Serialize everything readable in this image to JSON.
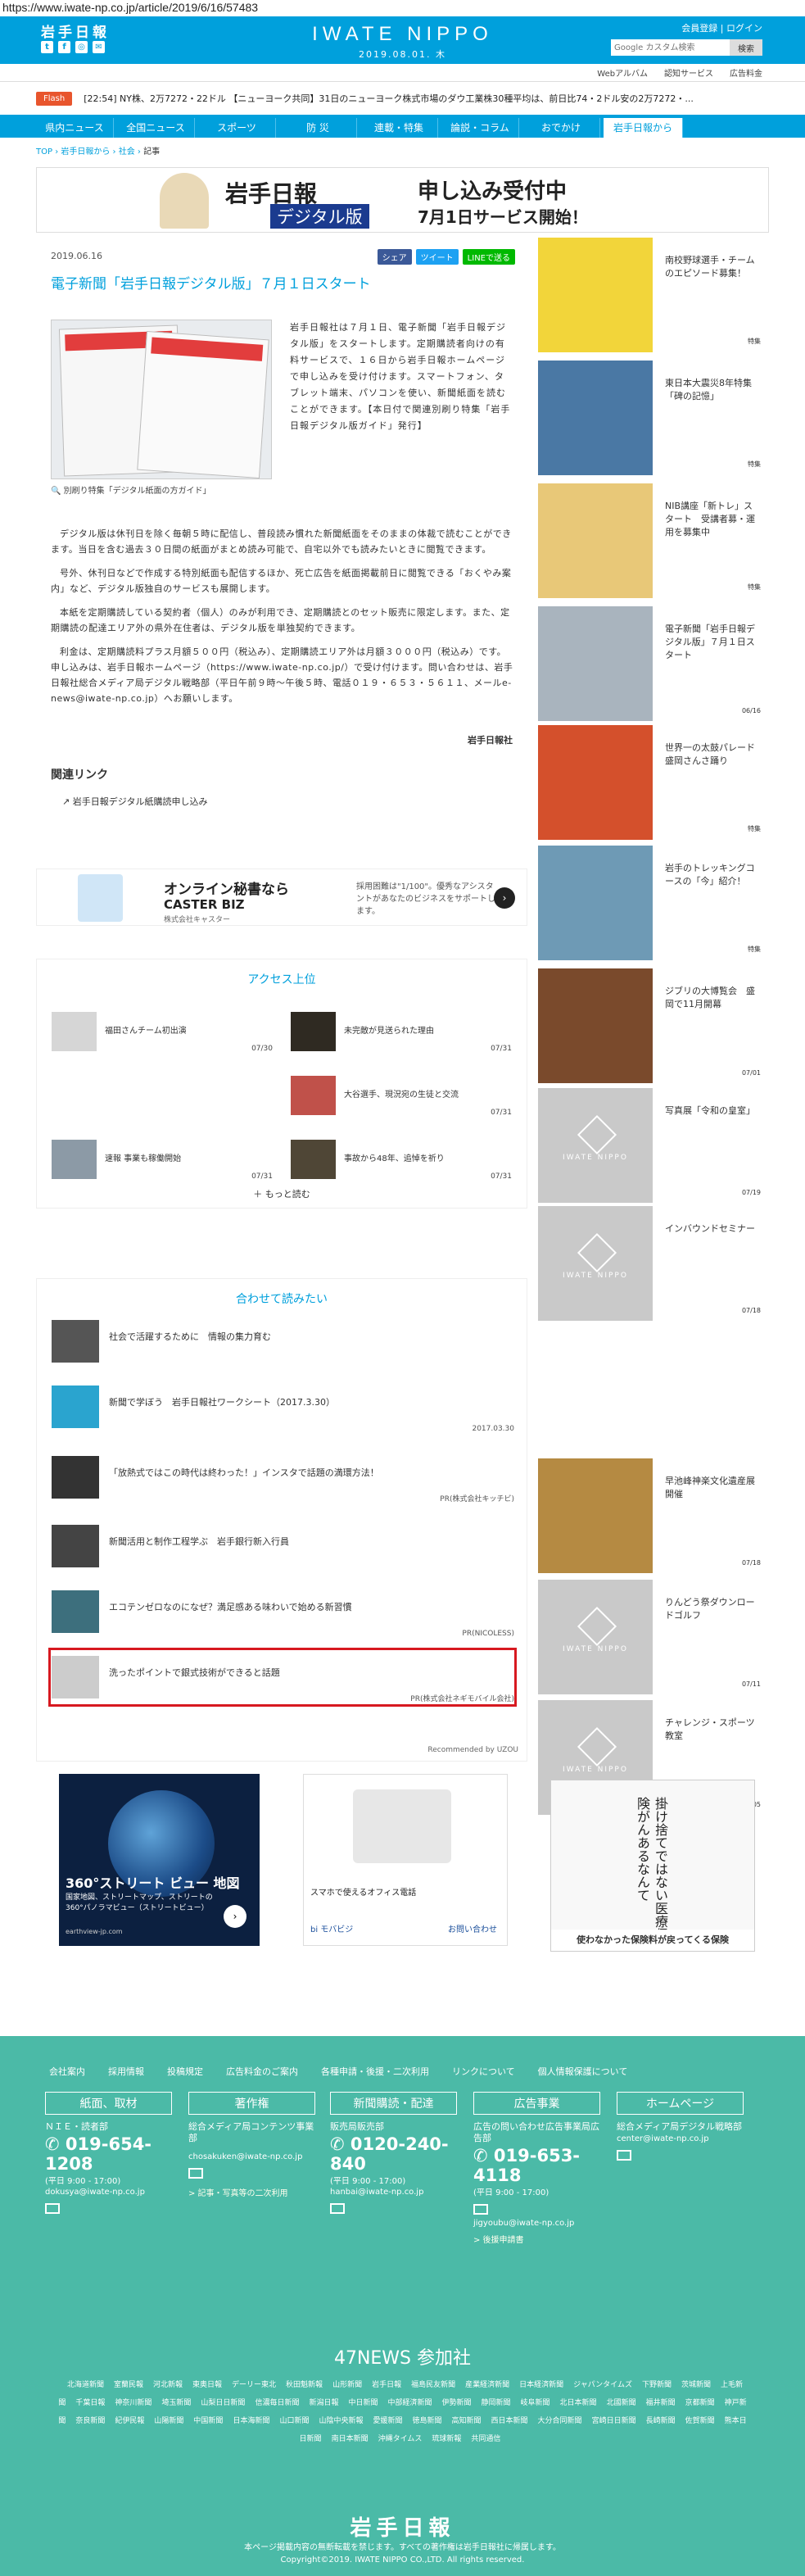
{
  "url": "https://www.iwate-np.co.jp/article/2019/6/16/57483",
  "header": {
    "logo": "岩手日報",
    "brand": "IWATE NIPPO",
    "date": "2019.08.01. 木",
    "member": "会員登録 | ログイン",
    "search_placeholder": "Google カスタム検索",
    "search_button": "検索"
  },
  "subnav": [
    "Webアルバム",
    "認知サービス",
    "広告料金"
  ],
  "flash": {
    "tag": "Flash",
    "text": "[22:54] NY株、2万7272・22ドル 【ニューヨーク共同】31日のニューヨーク株式市場のダウ工業株30種平均は、前日比74・2ドル安の2万7272・..."
  },
  "nav": [
    "県内ニュース",
    "全国ニュース",
    "スポーツ",
    "防 災",
    "連載・特集",
    "論説・コラム",
    "おでかけ",
    "岩手日報から"
  ],
  "breadcrumb": {
    "top": "TOP",
    "s1": "岩手日報から",
    "s2": "社会",
    "cur": "記事"
  },
  "banner": {
    "t1": "岩手日報",
    "t2": "デジタル版",
    "t3": "申し込み受付中",
    "t4": "7月1日サービス開始！"
  },
  "article": {
    "date": "2019.06.16",
    "share": {
      "fb": "シェア",
      "tw": "ツイート",
      "line": "LINEで送る"
    },
    "title": "電子新聞「岩手日報デジタル版」７月１日スタート",
    "caption": "別刷り特集「デジタル紙面の方ガイド」",
    "p1": "岩手日報社は７月１日、電子新聞「岩手日報デジタル版」をスタートします。定期購読者向けの有料サービスで、１６日から岩手日報ホームページで申し込みを受け付けます。スマートフォン、タブレット端末、パソコンを使い、新聞紙面を読むことができます。【本日付で関連別刷り特集「岩手日報デジタル版ガイド」発行】",
    "p2": "デジタル版は休刊日を除く毎朝５時に配信し、普段読み慣れた新聞紙面をそのままの体裁で読むことができます。当日を含む過去３０日間の紙面がまとめ読み可能で、自宅以外でも読みたいときに閲覧できます。",
    "p3": "号外、休刊日などで作成する特別紙面も配信するほか、死亡広告を紙面掲載前日に閲覧できる「おくやみ案内」など、デジタル版独自のサービスも展開します。",
    "p4": "本紙を定期購読している契約者（個人）のみが利用でき、定期購読とのセット販売に限定します。また、定期購読の配達エリア外の県外在住者は、デジタル版を単独契約できます。",
    "p5": "利金は、定期購読料プラス月額５００円（税込み）、定期購読エリア外は月額３０００円（税込み）です。申し込みは、岩手日報ホームページ（https://www.iwate-np.co.jp/）で受け付けます。問い合わせは、岩手日報社総合メディア局デジタル戦略部（平日午前９時～午後５時、電話０１９・６５３・５６１１、メールe-news@iwate-np.co.jp）へお願いします。",
    "sig": "岩手日報社",
    "related_title": "関連リンク",
    "related_link": "岩手日報デジタル紙購読申し込み"
  },
  "ad1": {
    "a": "オンライン秘書なら",
    "b": "CASTER BIZ",
    "c": "株式会社キャスター",
    "d": "採用困難は\"1/100\"。優秀なアシスタントがあなたのビジネスをサポートします。"
  },
  "rank": {
    "title": "アクセス上位",
    "items": [
      {
        "t": "福田さんチーム初出演",
        "d": "07/30"
      },
      {
        "t": "未完敵が見送られた理由",
        "d": "07/31"
      },
      {
        "t": "大谷選手、現況宛の生徒と交流",
        "d": "07/31"
      },
      {
        "t": "速報 事業も稼働開始",
        "d": "07/31"
      },
      {
        "t": "事故から48年、追悼を祈り",
        "d": "07/31"
      }
    ],
    "more": "＋ もっと読む"
  },
  "reco": {
    "title": "合わせて読みたい",
    "items": [
      {
        "t": "社会で活躍するために　情報の集力育む",
        "s": ""
      },
      {
        "t": "新聞で学ぼう　岩手日報社ワークシート（2017.3.30）",
        "s": "2017.03.30"
      },
      {
        "t": "「放熱式ではこの時代は終わった！」インスタで話題の満環方法！",
        "s": "PR(株式会社キッチビ)"
      },
      {
        "t": "新聞活用と制作工程学ぶ　岩手銀行新入行員",
        "s": ""
      },
      {
        "t": "エコテンゼロなのになぜ？満足感ある味わいで始める新習慣",
        "s": "PR(NICOLESS)"
      },
      {
        "t": "洗ったポイントで銀式技術ができると話題",
        "s": "PR(株式会社ネギモバイル会社)"
      }
    ],
    "powered": "Recommended by UZOU"
  },
  "ad2": {
    "t1": "360°ストリート ビュー 地図",
    "t2": "国家地図、ストリートマップ、ストリートの360°パノラマビュー（ストリートビュー）",
    "t3": "earthview-jp.com"
  },
  "ad3": {
    "t1": "スマホで使えるオフィス電話",
    "t2": "bi モバビジ",
    "t3": "お問い合わせ"
  },
  "side": [
    {
      "t": "南校野球選手・チームのエピソード募集！",
      "c": "特集"
    },
    {
      "t": "東日本大震災8年特集「碑の記憶」",
      "c": "特集"
    },
    {
      "t": "NIB講座「新トレ」スタート　受講者募・運用を募集中",
      "c": "特集"
    },
    {
      "t": "電子新聞「岩手日報デジタル版」７月１日スタート",
      "c": "06/16"
    },
    {
      "t": "世界一の太鼓パレード　盛岡さんさ踊り",
      "c": "特集"
    },
    {
      "t": "岩手のトレッキングコースの「今」紹介！",
      "c": "特集"
    },
    {
      "t": "ジブリの大博覧会　盛岡で11月開幕",
      "c": "07/01"
    },
    {
      "t": "写真展「令和の皇室」",
      "c": "07/19"
    },
    {
      "t": "インバウンドセミナー",
      "c": "07/18"
    },
    {
      "t": "早池峰神楽文化遺産展開催",
      "c": "07/18"
    },
    {
      "t": "りんどう祭ダウンロードゴルフ",
      "c": "07/11"
    },
    {
      "t": "チャレンジ・スポーツ教室",
      "c": "07/05"
    }
  ],
  "side_ad": {
    "txt": "掛け捨てではない医療保険がんあるなんて",
    "bot": "使わなかった保険料が戻ってくる保険"
  },
  "footer": {
    "nav": [
      "会社案内",
      "採用情報",
      "投稿規定",
      "広告料金のご案内",
      "各種申請・後援・二次利用",
      "リンクについて",
      "個人情報保護について"
    ],
    "cols": [
      {
        "h": "紙面、取材",
        "l": "ＮＩＥ・読者部",
        "tel": "019-654-1208",
        "sm": "(平日 9:00 - 17:00)",
        "mail": "dokusya@iwate-np.co.jp",
        "lnk": ""
      },
      {
        "h": "著作権",
        "l": "総合メディア局コンテンツ事業部",
        "tel": "",
        "sm": "",
        "mail": "chosakuken@iwate-np.co.jp",
        "lnk": "> 記事・写真等の二次利用"
      },
      {
        "h": "新聞購読・配達",
        "l": "販売局販売部",
        "tel": "0120-240-840",
        "sm": "(平日 9:00 - 17:00)",
        "mail": "hanbai@iwate-np.co.jp",
        "lnk": ""
      },
      {
        "h": "広告事業",
        "l": "広告の問い合わせ広告事業局広告部",
        "tel": "019-653-4118",
        "sm": "(平日 9:00 - 17:00)",
        "mail": "jigyoubu@iwate-np.co.jp",
        "lnk": "> 後援申請書"
      },
      {
        "h": "ホームページ",
        "l": "総合メディア局デジタル戦略部",
        "tel": "",
        "sm": "",
        "mail": "center@iwate-np.co.jp",
        "lnk": ""
      }
    ],
    "title47": "47NEWS 参加社",
    "pubs": [
      "北海道新聞",
      "室蘭民報",
      "河北新報",
      "東奥日報",
      "デーリー東北",
      "秋田魁新報",
      "山形新聞",
      "岩手日報",
      "福島民友新聞",
      "産業経済新聞",
      "日本経済新聞",
      "ジャパンタイムズ",
      "下野新聞",
      "茨城新聞",
      "上毛新聞",
      "千葉日報",
      "神奈川新聞",
      "埼玉新聞",
      "山梨日日新聞",
      "信濃毎日新聞",
      "新潟日報",
      "中日新聞",
      "中部経済新聞",
      "伊勢新聞",
      "静岡新聞",
      "岐阜新聞",
      "北日本新聞",
      "北國新聞",
      "福井新聞",
      "京都新聞",
      "神戸新聞",
      "奈良新聞",
      "紀伊民報",
      "山陽新聞",
      "中国新聞",
      "日本海新聞",
      "山口新聞",
      "山陰中央新報",
      "愛媛新聞",
      "徳島新聞",
      "高知新聞",
      "西日本新聞",
      "大分合同新聞",
      "宮崎日日新聞",
      "長崎新聞",
      "佐賀新聞",
      "熊本日日新聞",
      "南日本新聞",
      "沖縄タイムス",
      "琉球新報",
      "共同通信"
    ],
    "logo": "岩手日報",
    "copy1": "本ページ掲載内容の無断転載を禁じます。すべての著作権は岩手日報社に帰属します。",
    "copy2": "Copyright©2019. IWATE NIPPO CO.,LTD. All rights reserved."
  }
}
